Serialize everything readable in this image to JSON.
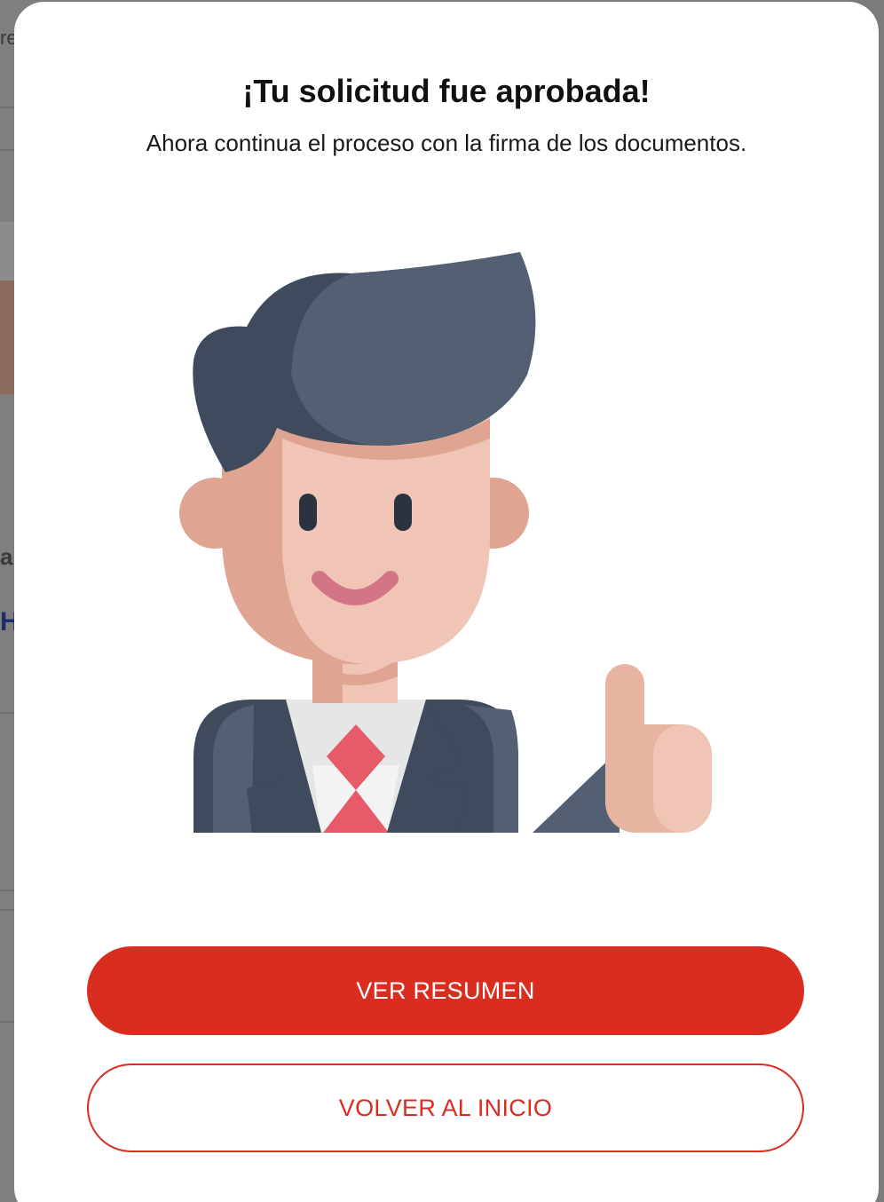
{
  "background": {
    "fragments": [
      "re",
      "a",
      "H"
    ]
  },
  "modal": {
    "title": "¡Tu solicitud fue aprobada!",
    "subtitle": "Ahora continua el proceso con la firma de los documentos.",
    "illustration_icon": "businessman-thumbs-up-icon",
    "primary_button_label": "VER RESUMEN",
    "secondary_button_label": "VOLVER AL INICIO"
  },
  "colors": {
    "accent": "#d92d20",
    "hair_dark": "#3f4a5c",
    "hair_light": "#536074",
    "skin": "#f0c5b5",
    "skin_shadow": "#e0a492",
    "tie": "#e75a6a"
  }
}
